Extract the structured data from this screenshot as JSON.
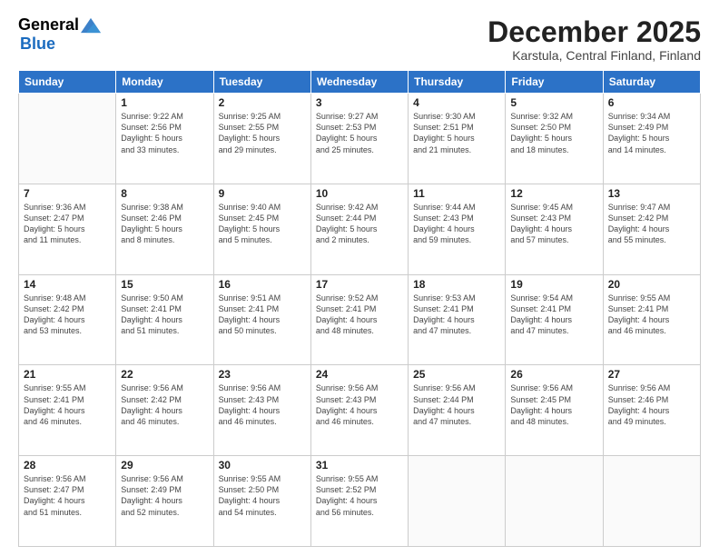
{
  "logo": {
    "general": "General",
    "blue": "Blue"
  },
  "header": {
    "month": "December 2025",
    "location": "Karstula, Central Finland, Finland"
  },
  "days_of_week": [
    "Sunday",
    "Monday",
    "Tuesday",
    "Wednesday",
    "Thursday",
    "Friday",
    "Saturday"
  ],
  "weeks": [
    [
      {
        "day": "",
        "sunrise": "",
        "sunset": "",
        "daylight": ""
      },
      {
        "day": "1",
        "sunrise": "Sunrise: 9:22 AM",
        "sunset": "Sunset: 2:56 PM",
        "daylight": "Daylight: 5 hours and 33 minutes."
      },
      {
        "day": "2",
        "sunrise": "Sunrise: 9:25 AM",
        "sunset": "Sunset: 2:55 PM",
        "daylight": "Daylight: 5 hours and 29 minutes."
      },
      {
        "day": "3",
        "sunrise": "Sunrise: 9:27 AM",
        "sunset": "Sunset: 2:53 PM",
        "daylight": "Daylight: 5 hours and 25 minutes."
      },
      {
        "day": "4",
        "sunrise": "Sunrise: 9:30 AM",
        "sunset": "Sunset: 2:51 PM",
        "daylight": "Daylight: 5 hours and 21 minutes."
      },
      {
        "day": "5",
        "sunrise": "Sunrise: 9:32 AM",
        "sunset": "Sunset: 2:50 PM",
        "daylight": "Daylight: 5 hours and 18 minutes."
      },
      {
        "day": "6",
        "sunrise": "Sunrise: 9:34 AM",
        "sunset": "Sunset: 2:49 PM",
        "daylight": "Daylight: 5 hours and 14 minutes."
      }
    ],
    [
      {
        "day": "7",
        "sunrise": "Sunrise: 9:36 AM",
        "sunset": "Sunset: 2:47 PM",
        "daylight": "Daylight: 5 hours and 11 minutes."
      },
      {
        "day": "8",
        "sunrise": "Sunrise: 9:38 AM",
        "sunset": "Sunset: 2:46 PM",
        "daylight": "Daylight: 5 hours and 8 minutes."
      },
      {
        "day": "9",
        "sunrise": "Sunrise: 9:40 AM",
        "sunset": "Sunset: 2:45 PM",
        "daylight": "Daylight: 5 hours and 5 minutes."
      },
      {
        "day": "10",
        "sunrise": "Sunrise: 9:42 AM",
        "sunset": "Sunset: 2:44 PM",
        "daylight": "Daylight: 5 hours and 2 minutes."
      },
      {
        "day": "11",
        "sunrise": "Sunrise: 9:44 AM",
        "sunset": "Sunset: 2:43 PM",
        "daylight": "Daylight: 4 hours and 59 minutes."
      },
      {
        "day": "12",
        "sunrise": "Sunrise: 9:45 AM",
        "sunset": "Sunset: 2:43 PM",
        "daylight": "Daylight: 4 hours and 57 minutes."
      },
      {
        "day": "13",
        "sunrise": "Sunrise: 9:47 AM",
        "sunset": "Sunset: 2:42 PM",
        "daylight": "Daylight: 4 hours and 55 minutes."
      }
    ],
    [
      {
        "day": "14",
        "sunrise": "Sunrise: 9:48 AM",
        "sunset": "Sunset: 2:42 PM",
        "daylight": "Daylight: 4 hours and 53 minutes."
      },
      {
        "day": "15",
        "sunrise": "Sunrise: 9:50 AM",
        "sunset": "Sunset: 2:41 PM",
        "daylight": "Daylight: 4 hours and 51 minutes."
      },
      {
        "day": "16",
        "sunrise": "Sunrise: 9:51 AM",
        "sunset": "Sunset: 2:41 PM",
        "daylight": "Daylight: 4 hours and 50 minutes."
      },
      {
        "day": "17",
        "sunrise": "Sunrise: 9:52 AM",
        "sunset": "Sunset: 2:41 PM",
        "daylight": "Daylight: 4 hours and 48 minutes."
      },
      {
        "day": "18",
        "sunrise": "Sunrise: 9:53 AM",
        "sunset": "Sunset: 2:41 PM",
        "daylight": "Daylight: 4 hours and 47 minutes."
      },
      {
        "day": "19",
        "sunrise": "Sunrise: 9:54 AM",
        "sunset": "Sunset: 2:41 PM",
        "daylight": "Daylight: 4 hours and 47 minutes."
      },
      {
        "day": "20",
        "sunrise": "Sunrise: 9:55 AM",
        "sunset": "Sunset: 2:41 PM",
        "daylight": "Daylight: 4 hours and 46 minutes."
      }
    ],
    [
      {
        "day": "21",
        "sunrise": "Sunrise: 9:55 AM",
        "sunset": "Sunset: 2:41 PM",
        "daylight": "Daylight: 4 hours and 46 minutes."
      },
      {
        "day": "22",
        "sunrise": "Sunrise: 9:56 AM",
        "sunset": "Sunset: 2:42 PM",
        "daylight": "Daylight: 4 hours and 46 minutes."
      },
      {
        "day": "23",
        "sunrise": "Sunrise: 9:56 AM",
        "sunset": "Sunset: 2:43 PM",
        "daylight": "Daylight: 4 hours and 46 minutes."
      },
      {
        "day": "24",
        "sunrise": "Sunrise: 9:56 AM",
        "sunset": "Sunset: 2:43 PM",
        "daylight": "Daylight: 4 hours and 46 minutes."
      },
      {
        "day": "25",
        "sunrise": "Sunrise: 9:56 AM",
        "sunset": "Sunset: 2:44 PM",
        "daylight": "Daylight: 4 hours and 47 minutes."
      },
      {
        "day": "26",
        "sunrise": "Sunrise: 9:56 AM",
        "sunset": "Sunset: 2:45 PM",
        "daylight": "Daylight: 4 hours and 48 minutes."
      },
      {
        "day": "27",
        "sunrise": "Sunrise: 9:56 AM",
        "sunset": "Sunset: 2:46 PM",
        "daylight": "Daylight: 4 hours and 49 minutes."
      }
    ],
    [
      {
        "day": "28",
        "sunrise": "Sunrise: 9:56 AM",
        "sunset": "Sunset: 2:47 PM",
        "daylight": "Daylight: 4 hours and 51 minutes."
      },
      {
        "day": "29",
        "sunrise": "Sunrise: 9:56 AM",
        "sunset": "Sunset: 2:49 PM",
        "daylight": "Daylight: 4 hours and 52 minutes."
      },
      {
        "day": "30",
        "sunrise": "Sunrise: 9:55 AM",
        "sunset": "Sunset: 2:50 PM",
        "daylight": "Daylight: 4 hours and 54 minutes."
      },
      {
        "day": "31",
        "sunrise": "Sunrise: 9:55 AM",
        "sunset": "Sunset: 2:52 PM",
        "daylight": "Daylight: 4 hours and 56 minutes."
      },
      {
        "day": "",
        "sunrise": "",
        "sunset": "",
        "daylight": ""
      },
      {
        "day": "",
        "sunrise": "",
        "sunset": "",
        "daylight": ""
      },
      {
        "day": "",
        "sunrise": "",
        "sunset": "",
        "daylight": ""
      }
    ]
  ]
}
